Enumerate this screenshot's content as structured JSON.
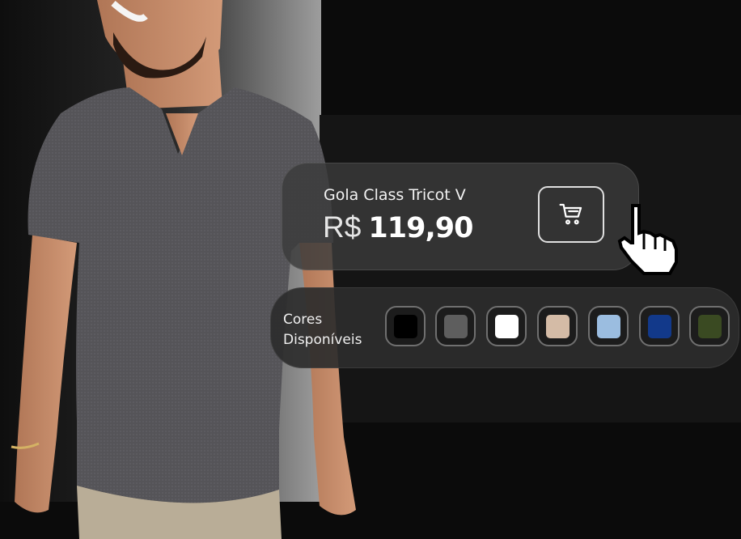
{
  "product": {
    "name": "Gola Class Tricot V",
    "currency": "R$",
    "price": "119,90",
    "cart_icon": "cart-icon"
  },
  "colors": {
    "label_line1": "Cores",
    "label_line2": "Disponíveis",
    "swatches": [
      {
        "name": "black",
        "hex": "#000000"
      },
      {
        "name": "dark-gray",
        "hex": "#5e5e5e"
      },
      {
        "name": "white",
        "hex": "#ffffff"
      },
      {
        "name": "beige",
        "hex": "#d4bba6"
      },
      {
        "name": "light-blue",
        "hex": "#9bbde0"
      },
      {
        "name": "navy",
        "hex": "#12398a"
      },
      {
        "name": "olive",
        "hex": "#3a4a22"
      }
    ]
  },
  "cursor_icon": "hand-pointer-icon"
}
